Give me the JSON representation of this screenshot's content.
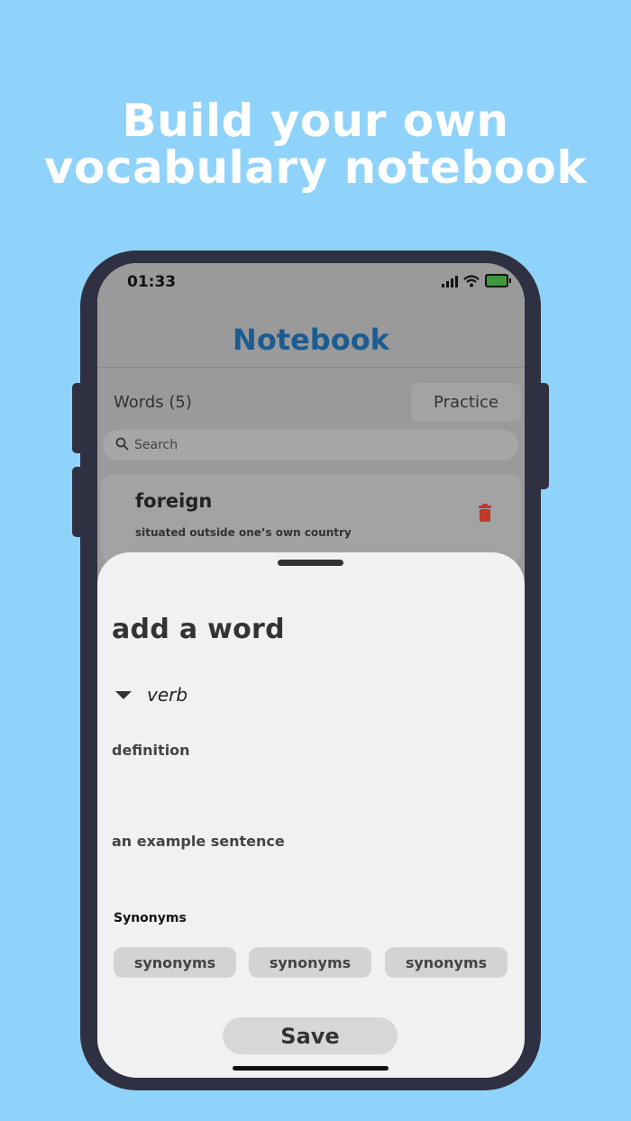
{
  "headline": {
    "line1": "Build your own",
    "line2": "vocabulary notebook"
  },
  "status_bar": {
    "time": "01:33"
  },
  "app": {
    "title": "Notebook",
    "words_label": "Words (5)",
    "practice_label": "Practice",
    "search_placeholder": "Search",
    "word_card": {
      "word": "foreign",
      "definition": "situated outside one’s own country"
    }
  },
  "sheet": {
    "title": "add a word",
    "part_of_speech": "verb",
    "definition_label": "definition",
    "example_label": "an example sentence",
    "synonyms_label": "Synonyms",
    "synonym_chips": [
      "synonyms",
      "synonyms",
      "synonyms"
    ],
    "save_label": "Save"
  },
  "colors": {
    "background": "#8fd3fb",
    "phone_frame": "#2f3142",
    "brand_title": "#1b5c92",
    "delete_red": "#c0392b",
    "battery_green": "#3c9a3c"
  },
  "icons": [
    "search-icon",
    "trash-icon",
    "wifi-icon",
    "signal-icon",
    "battery-icon",
    "caret-down-icon"
  ]
}
